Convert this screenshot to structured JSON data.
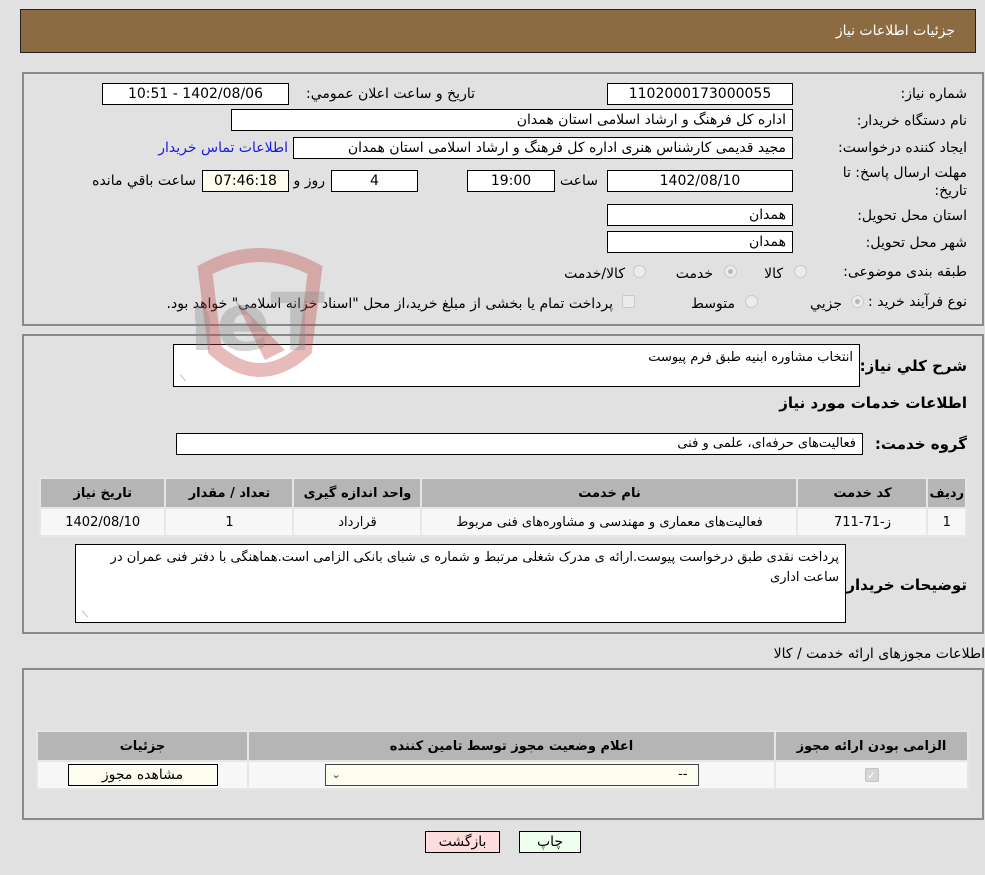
{
  "header": {
    "title": "جزئیات اطلاعات نیاز"
  },
  "form": {
    "need_number": {
      "label": "شماره نیاز:",
      "value": "1102000173000055"
    },
    "announce_datetime": {
      "label": "تاریخ و ساعت اعلان عمومي:",
      "value": "1402/08/06 - 10:51"
    },
    "buyer_org": {
      "label": "نام دستگاه خریدار:",
      "value": "اداره کل فرهنگ و ارشاد اسلامی استان همدان"
    },
    "requester": {
      "label": "ایجاد کننده درخواست:",
      "value": "مجید قدیمی کارشناس هنری اداره کل فرهنگ و ارشاد اسلامی استان همدان"
    },
    "buyer_contact_link": "اطلاعات تماس خریدار",
    "deadline": {
      "label": "مهلت ارسال پاسخ: تا تاریخ:",
      "date": "1402/08/10",
      "time_label": "ساعت",
      "time": "19:00",
      "days": "4",
      "days_label": "روز و",
      "remaining": "07:46:18",
      "remaining_label": "ساعت باقي مانده"
    },
    "delivery_province": {
      "label": "استان محل تحویل:",
      "value": "همدان"
    },
    "delivery_city": {
      "label": "شهر محل تحویل:",
      "value": "همدان"
    },
    "category": {
      "label": "طبقه بندی موضوعی:",
      "options": [
        "کالا",
        "خدمت",
        "کالا/خدمت"
      ],
      "selected": "خدمت"
    },
    "purchase_type": {
      "label": "نوع فرآیند خرید :",
      "options": [
        "جزيي",
        "متوسط"
      ],
      "selected": "جزيي",
      "treasury_note": "پرداخت تمام یا بخشی از مبلغ خرید،از محل \"اسناد خزانه اسلامی\" خواهد بود.",
      "treasury_checked": false
    }
  },
  "description": {
    "label": "شرح کلي نیاز:",
    "value": "انتخاب مشاوره ابنیه طبق فرم پیوست"
  },
  "services": {
    "section_title": "اطلاعات خدمات مورد نیاز",
    "group_label": "گروه خدمت:",
    "group_value": "فعالیت‌های حرفه‌ای، علمی و فنی",
    "table": {
      "headers": [
        "ردیف",
        "کد خدمت",
        "نام خدمت",
        "واحد اندازه گیری",
        "تعداد / مقدار",
        "تاریخ نیاز"
      ],
      "rows": [
        [
          "1",
          "ز-71-711",
          "فعالیت‌های معماری و مهندسی و مشاوره‌های فنی مربوط",
          "قرارداد",
          "1",
          "1402/08/10"
        ]
      ]
    }
  },
  "buyer_notes": {
    "label": "توضیحات خریدار:",
    "value": "پرداخت نقدی طبق درخواست پیوست.ارائه ی مدرک شغلی مرتبط و شماره ی شبای بانکی الزامی است.هماهنگی با دفتر فنی عمران در ساعت اداری"
  },
  "permits": {
    "section_title": "اطلاعات مجوزهای ارائه خدمت / کالا",
    "headers": [
      "الزامی بودن ارائه مجوز",
      "اعلام وضعیت مجوز توسط تامین کننده",
      "جزئیات"
    ],
    "row": {
      "required_checked": true,
      "status_selected": "--",
      "details_button": "مشاهده مجوز"
    }
  },
  "footer": {
    "print_button": "چاپ",
    "back_button": "بازگشت"
  },
  "colors": {
    "header_bg": "#8c6b42",
    "print_bg": "#eeffee",
    "back_bg": "#ffdddd",
    "link": "#1a1adb"
  },
  "watermark": "AriaTender.neT"
}
